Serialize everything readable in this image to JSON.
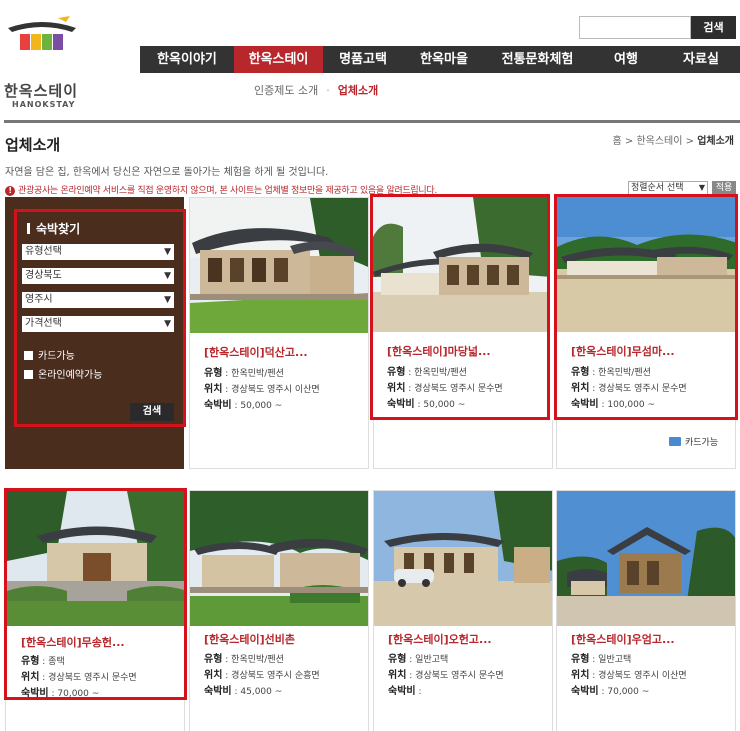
{
  "header": {
    "logo_text": "한옥스테이",
    "logo_sub": "HANOKSTAY",
    "search_button": "검색",
    "search_value": "",
    "nav": [
      "한옥이야기",
      "한옥스테이",
      "명품고택",
      "한옥마을",
      "전통문화체험",
      "여행",
      "자료실"
    ],
    "nav_active": "한옥스테이",
    "subnav": [
      "인증제도 소개",
      "업체소개"
    ]
  },
  "page": {
    "title": "업체소개",
    "breadcrumb": [
      "홈",
      "한옥스테이",
      "업체소개"
    ],
    "description": "자연을 담은 집, 한옥에서 당신은 자연으로 돌아가는 체험을 하게 될 것입니다.",
    "notice": "관광공사는 온라인예약 서비스를 직접 운영하지 않으며, 본 사이트는 업체별 정보만을 제공하고 있음을 알려드립니다.",
    "sort_label": "정렬순서 선택",
    "sort_apply": "적용"
  },
  "search_panel": {
    "title": "숙박찾기",
    "selects": [
      "유형선택",
      "경상북도",
      "영주시",
      "가격선택"
    ],
    "checkboxes": [
      "카드가능",
      "온라인예약가능"
    ],
    "button": "검색"
  },
  "labels": {
    "type": "유형",
    "location": "위치",
    "price": "숙박비",
    "card_badge": "카드가능"
  },
  "cards": [
    {
      "title": "[한옥스테이]덕산고...",
      "type": "한옥민박/펜션",
      "location": "경상북도 영주시 이산면",
      "price": "50,000 ~"
    },
    {
      "title": "[한옥스테이]마당넓...",
      "type": "한옥민박/펜션",
      "location": "경상북도 영주시 문수면",
      "price": "50,000 ~"
    },
    {
      "title": "[한옥스테이]무섬마...",
      "type": "한옥민박/펜션",
      "location": "경상북도 영주시 문수면",
      "price": "100,000 ~",
      "badge": "카드가능"
    },
    {
      "title": "[한옥스테이]무송헌...",
      "type": "종택",
      "location": "경상북도 영주시 문수면",
      "price": "70,000 ~"
    },
    {
      "title": "[한옥스테이]선비촌",
      "type": "한옥민박/펜션",
      "location": "경상북도 영주시 순흥면",
      "price": "45,000 ~"
    },
    {
      "title": "[한옥스테이]오헌고...",
      "type": "일반고택",
      "location": "경상북도 영주시 문수면",
      "price": ""
    },
    {
      "title": "[한옥스테이]우엄고...",
      "type": "일반고택",
      "location": "경상북도 영주시 이산면",
      "price": "70,000 ~"
    }
  ],
  "colors": {
    "accent": "#b8272c",
    "nav_bg": "#333333",
    "panel_bg": "#4a2d1d",
    "highlight": "#d5121b"
  }
}
